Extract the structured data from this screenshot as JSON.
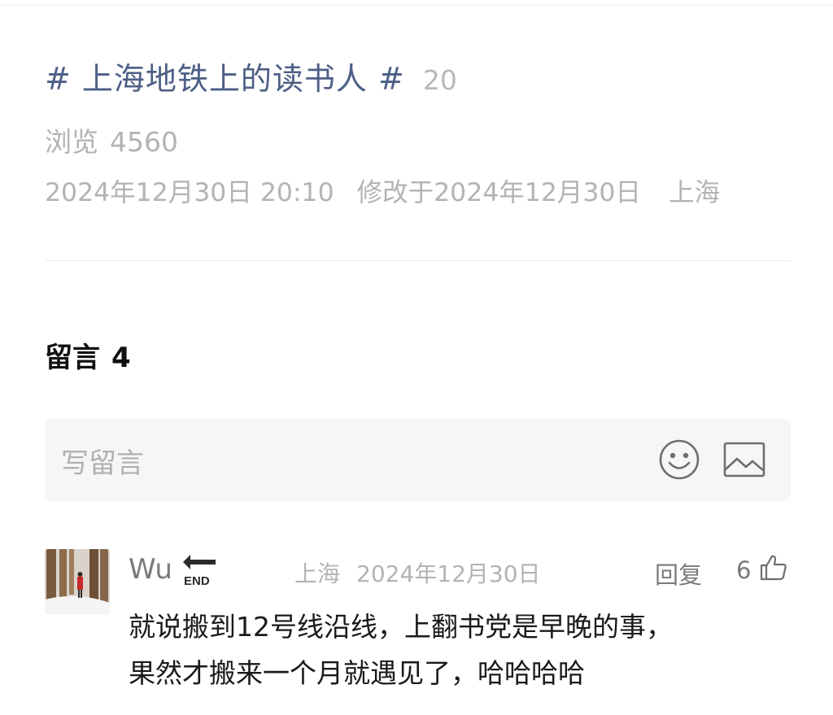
{
  "post": {
    "topic": "# 上海地铁上的读书人 #",
    "topic_count": "20",
    "views_label": "浏览",
    "views_count": "4560",
    "published": "2024年12月30日 20:10",
    "modified": "修改于2024年12月30日",
    "location": "上海"
  },
  "comments": {
    "header_label": "留言",
    "header_count": "4",
    "input_placeholder": "写留言",
    "emoji_icon": "emoji-smile-icon",
    "image_icon": "image-picture-icon",
    "items": [
      {
        "user": "Wu",
        "badge_icon": "end-arrow-icon",
        "location": "上海",
        "date": "2024年12月30日",
        "reply_label": "回复",
        "likes": "6",
        "like_icon": "thumbs-up-icon",
        "lines": [
          "就说搬到12号线沿线，上翻书党是早晚的事，",
          "果然才搬来一个月就遇见了，哈哈哈哈"
        ]
      }
    ]
  },
  "colors": {
    "topic": "#4d5f86",
    "muted": "#b3b3b3",
    "input_bg": "#f6f6f6"
  }
}
